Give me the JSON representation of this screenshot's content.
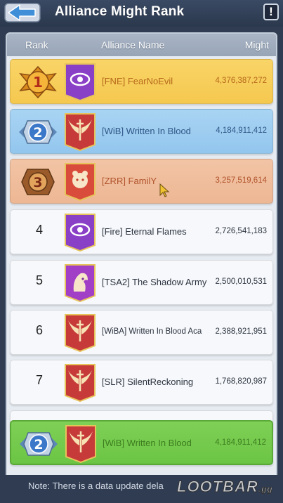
{
  "header": {
    "title": "Alliance Might Rank",
    "info_glyph": "!"
  },
  "columns": {
    "rank": "Rank",
    "name": "Alliance Name",
    "might": "Might"
  },
  "rows": [
    {
      "rank": "1",
      "tier": "gold",
      "banner": "eye-emblem",
      "banner_color": "#8a3fc7",
      "name": "[FNE] FearNoEvil",
      "might": "4,376,387,272"
    },
    {
      "rank": "2",
      "tier": "silver",
      "banner": "winged-sword-emblem",
      "banner_color": "#c73a3a",
      "name": "[WiB] Written In Blood",
      "might": "4,184,911,412"
    },
    {
      "rank": "3",
      "tier": "bronze",
      "banner": "beast-emblem",
      "banner_color": "#d94b3b",
      "name": "[ZRR] FamilY",
      "might": "3,257,519,614"
    },
    {
      "rank": "4",
      "tier": "normal",
      "banner": "eye-emblem",
      "banner_color": "#8a3fc7",
      "name": "[Fire] Eternal Flames",
      "might": "2,726,541,183"
    },
    {
      "rank": "5",
      "tier": "normal",
      "banner": "warrior-emblem",
      "banner_color": "#a23fc7",
      "name": "[TSA2] The Shadow Army",
      "might": "2,500,010,531"
    },
    {
      "rank": "6",
      "tier": "normal",
      "banner": "winged-sword-emblem",
      "banner_color": "#c73a3a",
      "name": "[WiBA] Written In Blood Aca",
      "might": "2,388,921,951"
    },
    {
      "rank": "7",
      "tier": "normal",
      "banner": "winged-sword-emblem",
      "banner_color": "#c73a3a",
      "name": "[SLR] SilentReckoning",
      "might": "1,768,820,987"
    }
  ],
  "my_alliance": {
    "rank": "2",
    "tier": "silver",
    "banner": "winged-sword-emblem",
    "banner_color": "#c73a3a",
    "name": "[WiB] Written In Blood",
    "might": "4,184,911,412"
  },
  "footer": {
    "note": "Note: There is a data update dela",
    "watermark": "LOOTBAR",
    "watermark_suffix": ".gg"
  },
  "colors": {
    "gold": "#f5c84f",
    "silver": "#93c6ee",
    "bronze": "#edb794",
    "mine": "#6cc544",
    "header_bg": "#2f3c52"
  }
}
